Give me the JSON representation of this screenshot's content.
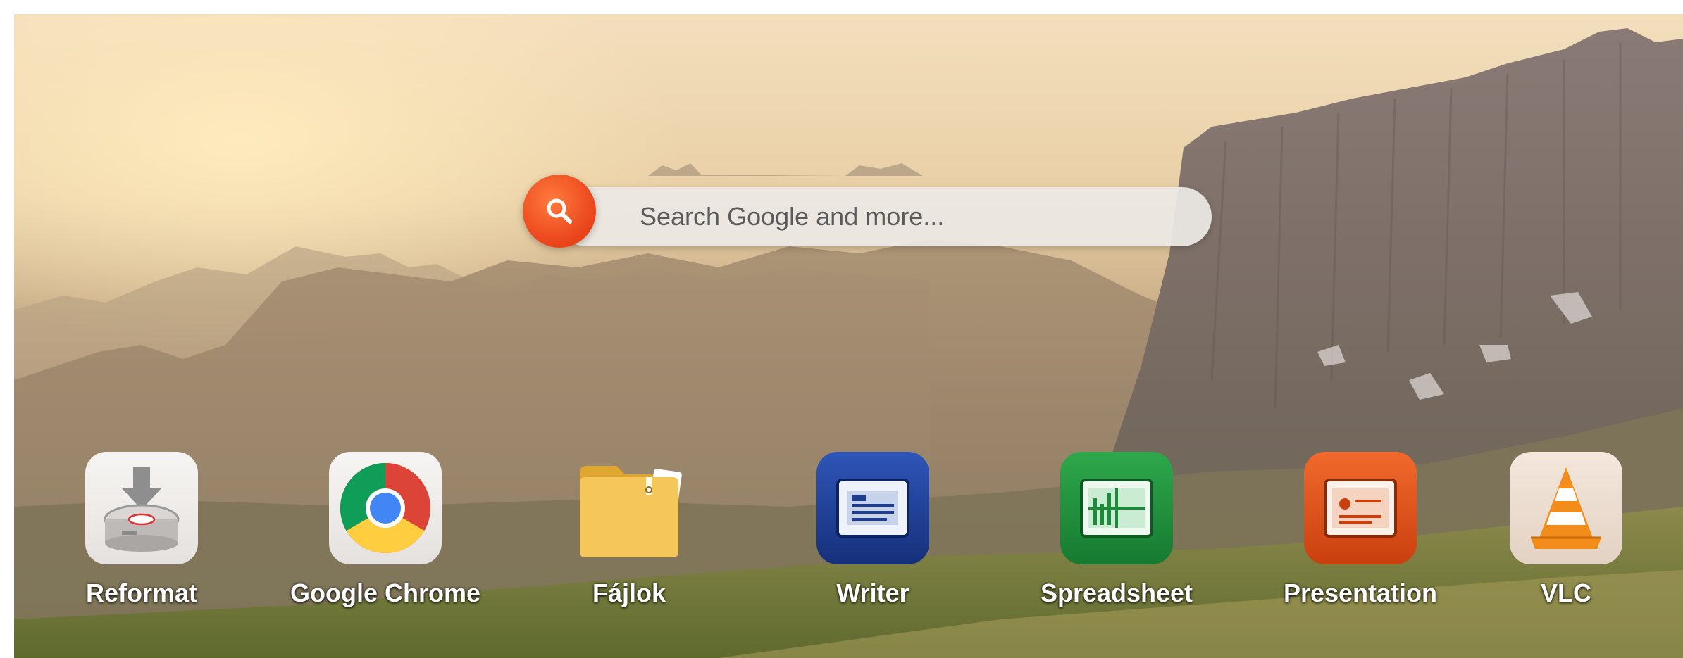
{
  "search": {
    "placeholder": "Search Google and more...",
    "button_icon": "search-icon",
    "accent": "#f05a24"
  },
  "apps": [
    {
      "label": "Reformat",
      "icon": "reformat-icon"
    },
    {
      "label": "Google Chrome",
      "icon": "chrome-icon"
    },
    {
      "label": "Fájlok",
      "icon": "folder-icon"
    },
    {
      "label": "Writer",
      "icon": "writer-icon"
    },
    {
      "label": "Spreadsheet",
      "icon": "spreadsheet-icon"
    },
    {
      "label": "Presentation",
      "icon": "presentation-icon"
    },
    {
      "label": "VLC",
      "icon": "vlc-icon"
    }
  ],
  "colors": {
    "writer": "#1f3d8f",
    "spreadsheet": "#1d8a3a",
    "presentation": "#e4531e",
    "folder": "#f2bf4e",
    "vlc": "#f28c1a"
  }
}
